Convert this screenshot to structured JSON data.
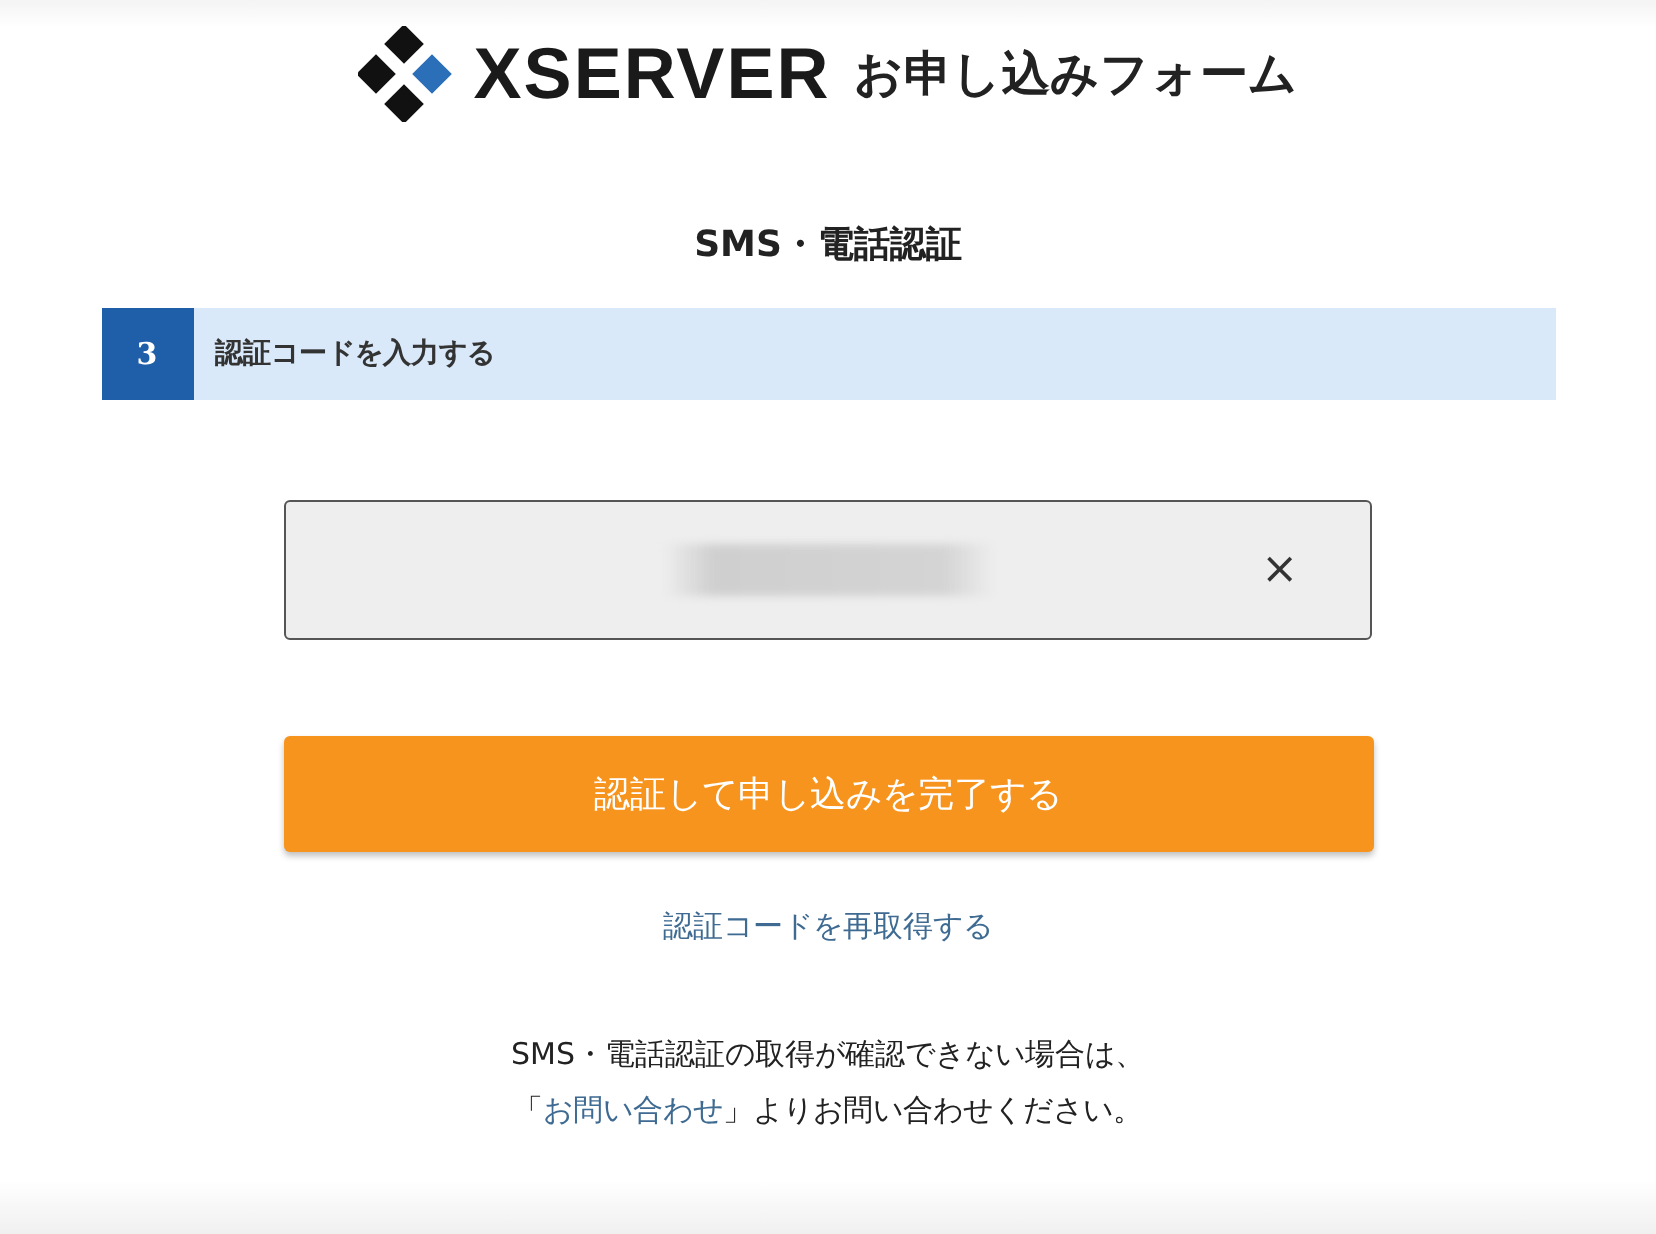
{
  "header": {
    "brand": "XSERVER",
    "subtitle": "お申し込みフォーム"
  },
  "page_title": "SMS・電話認証",
  "step": {
    "number": "3",
    "label": "認証コードを入力する"
  },
  "code_field": {
    "clear": "×"
  },
  "submit_button": "認証して申し込みを完了する",
  "resend_link": "認証コードを再取得する",
  "notice": {
    "text": "SMS・電話認証の取得が確認できない場合は、",
    "open": "「",
    "link": "お問い合わせ",
    "after": "」よりお問い合わせください。"
  }
}
